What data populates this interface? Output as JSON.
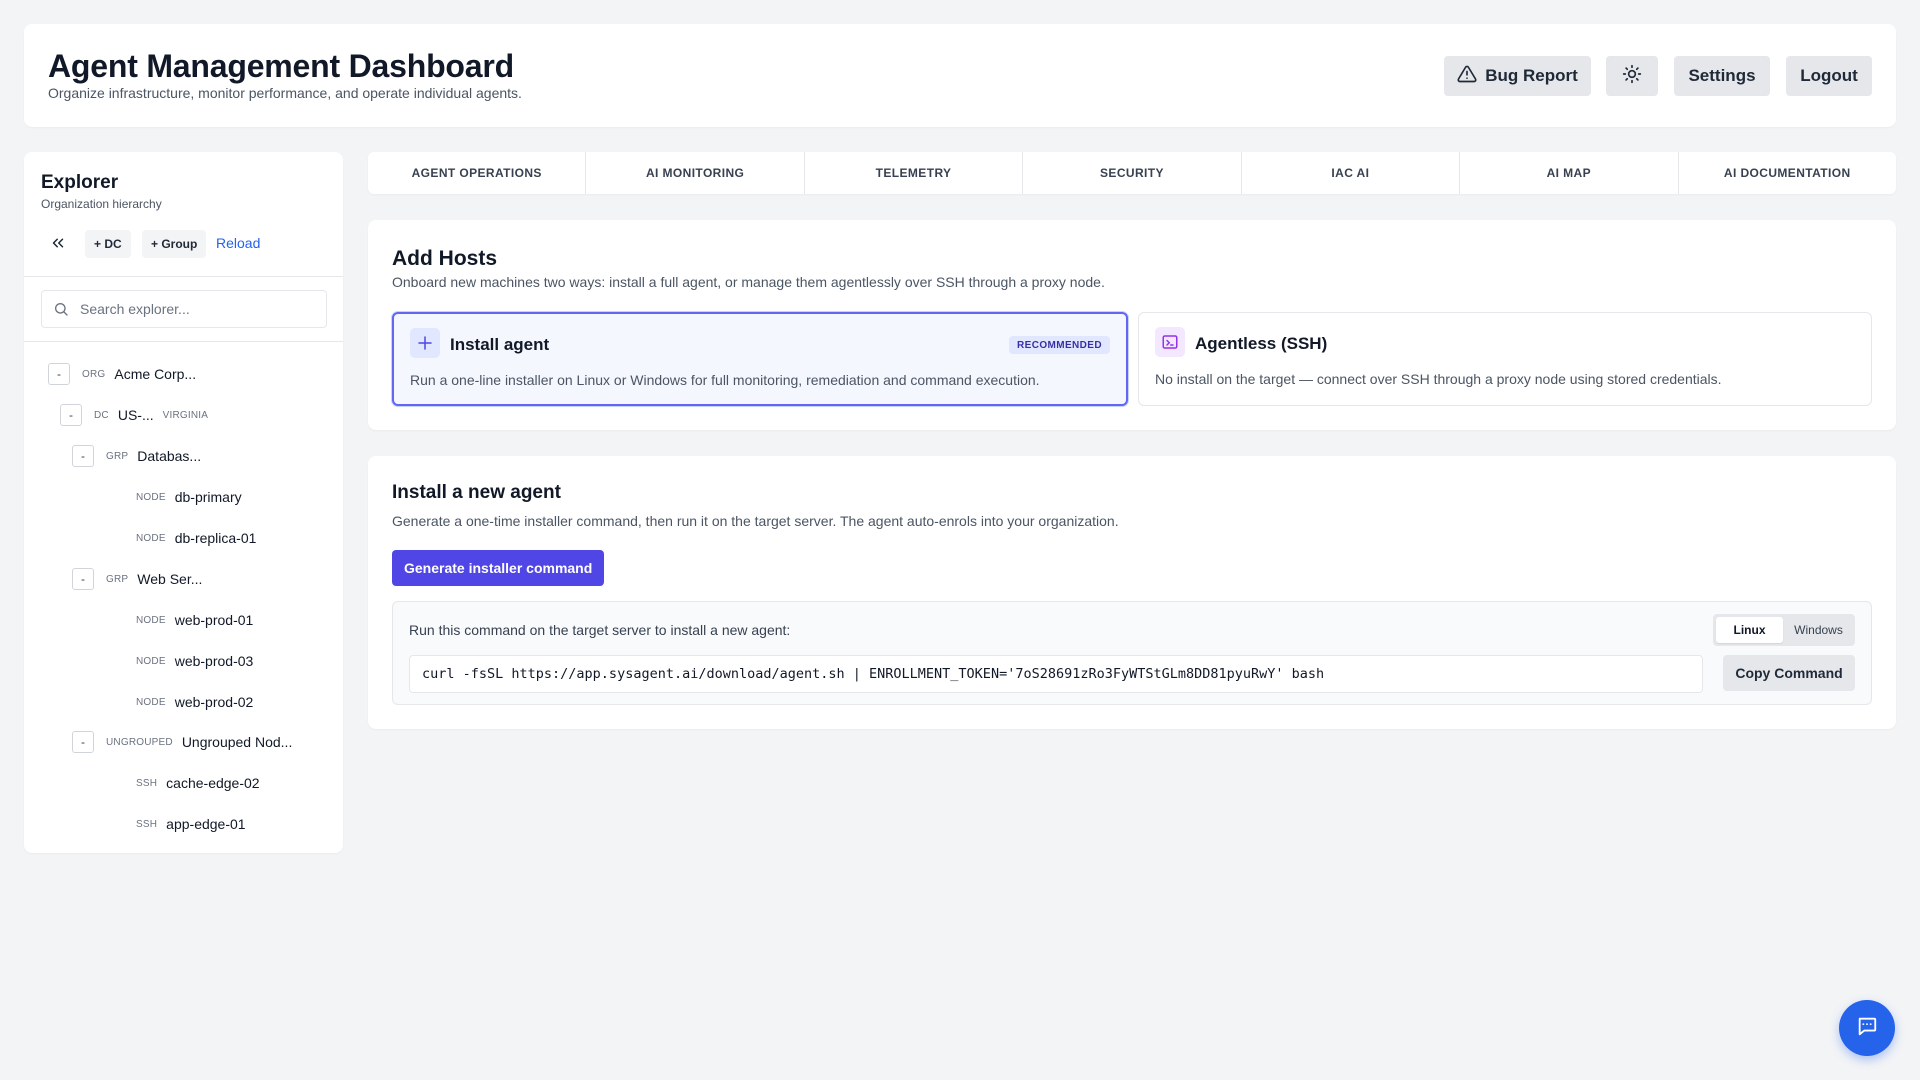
{
  "header": {
    "title": "Agent Management Dashboard",
    "subtitle": "Organize infrastructure, monitor performance, and operate individual agents.",
    "bug_report_label": "Bug Report",
    "theme_icon": "sun-icon",
    "settings_label": "Settings",
    "logout_label": "Logout"
  },
  "sidebar": {
    "title": "Explorer",
    "subtitle": "Organization hierarchy",
    "add_dc_label": "+ DC",
    "add_group_label": "+ Group",
    "reload_label": "Reload",
    "search_placeholder": "Search explorer...",
    "tree": [
      {
        "toggle": "-",
        "type": "ORG",
        "name": "Acme Corp...",
        "meta": ""
      },
      {
        "toggle": "-",
        "type": "DC",
        "name": "US-...",
        "meta": "VIRGINIA"
      },
      {
        "toggle": "-",
        "type": "GRP",
        "name": "Databas...",
        "meta": ""
      },
      {
        "toggle": "",
        "type": "NODE",
        "name": "db-primary",
        "meta": ""
      },
      {
        "toggle": "",
        "type": "NODE",
        "name": "db-replica-01",
        "meta": ""
      },
      {
        "toggle": "-",
        "type": "GRP",
        "name": "Web Ser...",
        "meta": ""
      },
      {
        "toggle": "",
        "type": "NODE",
        "name": "web-prod-01",
        "meta": ""
      },
      {
        "toggle": "",
        "type": "NODE",
        "name": "web-prod-03",
        "meta": ""
      },
      {
        "toggle": "",
        "type": "NODE",
        "name": "web-prod-02",
        "meta": ""
      },
      {
        "toggle": "-",
        "type": "UNGROUPED",
        "name": "Ungrouped Nod...",
        "meta": ""
      },
      {
        "toggle": "",
        "type": "SSH",
        "name": "cache-edge-02",
        "meta": ""
      },
      {
        "toggle": "",
        "type": "SSH",
        "name": "app-edge-01",
        "meta": ""
      }
    ]
  },
  "tabs": [
    "AGENT OPERATIONS",
    "AI MONITORING",
    "TELEMETRY",
    "SECURITY",
    "IAC AI",
    "AI MAP",
    "AI DOCUMENTATION"
  ],
  "add_hosts": {
    "title": "Add Hosts",
    "description": "Onboard new machines two ways: install a full agent, or manage them agentlessly over SSH through a proxy node.",
    "install_option": {
      "title": "Install agent",
      "badge": "RECOMMENDED",
      "description": "Run a one-line installer on Linux or Windows for full monitoring, remediation and command execution."
    },
    "ssh_option": {
      "title": "Agentless (SSH)",
      "description": "No install on the target — connect over SSH through a proxy node using stored credentials."
    }
  },
  "install": {
    "title": "Install a new agent",
    "description": "Generate a one-time installer command, then run it on the target server. The agent auto-enrols into your organization.",
    "generate_label": "Generate installer command",
    "command_label": "Run this command on the target server to install a new agent:",
    "os_options": [
      "Linux",
      "Windows"
    ],
    "selected_os": "Linux",
    "command": "curl -fsSL https://app.sysagent.ai/download/agent.sh | ENROLLMENT_TOKEN='7oS28691zRo3FyWTStGLm8DD81pyuRwY' bash",
    "copy_label": "Copy Command"
  },
  "colors": {
    "accent": "#4f46e5",
    "link": "#2563eb",
    "fab": "#2563eb"
  }
}
